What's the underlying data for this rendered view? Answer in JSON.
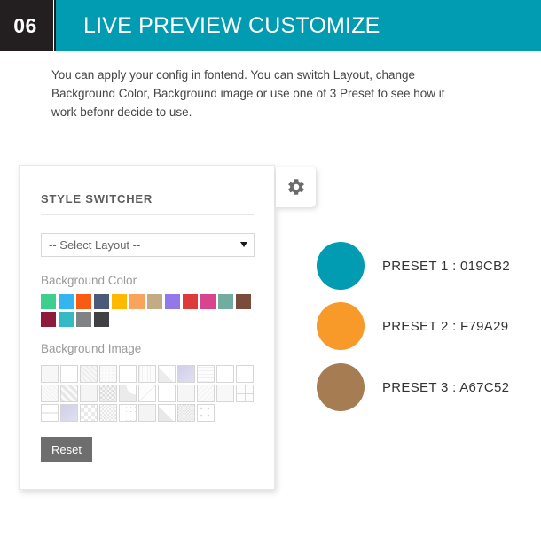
{
  "header": {
    "number": "06",
    "title": "LIVE PREVIEW CUSTOMIZE",
    "number_bg": "#231f20",
    "bar_bg": "#019cb2"
  },
  "intro": {
    "text": "You can apply your config in fontend. You can switch Layout, change Background Color, Background image or use one of 3 Preset to see how it work befonr decide to use."
  },
  "panel": {
    "title": "STYLE SWITCHER",
    "layout_select": {
      "value": "-- Select Layout --",
      "arrow_icon": "chevron-down-icon"
    },
    "background_color": {
      "label": "Background Color",
      "swatches": [
        "#3ECF8E",
        "#35B5EF",
        "#FA5B13",
        "#4A5A79",
        "#FFB900",
        "#F8A45C",
        "#C3AC83",
        "#9179EA",
        "#DD3A3A",
        "#D9448F",
        "#71AC9E",
        "#7A4C3C",
        "#8E1B3D",
        "#35BAC4",
        "#808285",
        "#414042"
      ]
    },
    "background_image": {
      "label": "Background Image",
      "tiles": [
        "plain-light",
        "plain-white",
        "noise-dense",
        "speckle",
        "plain-white",
        "fine-noise",
        "corner-fold",
        "lavender-solid",
        "fine-grid",
        "plain-white",
        "plain-white",
        "texture-soft",
        "diagonal-lines",
        "plain-light",
        "checker-dense",
        "curve-sweep",
        "diagonal-line",
        "plain-white",
        "plain-light",
        "soft-noise",
        "plain-light",
        "quad-grid",
        "horizontal-bands",
        "lavender-gradient",
        "diamond-cross",
        "dot-grid",
        "tiny-dots",
        "plain-light",
        "corner-triangle",
        "zigzag-texture",
        "sparse-dots"
      ]
    },
    "reset_label": "Reset"
  },
  "gear_tab": {
    "icon": "gear-icon"
  },
  "presets": [
    {
      "label": "PRESET 1 : 019CB2",
      "color": "#019CB2"
    },
    {
      "label": "PRESET 2 : F79A29",
      "color": "#F79A29"
    },
    {
      "label": "PRESET 3 : A67C52",
      "color": "#A67C52"
    }
  ]
}
